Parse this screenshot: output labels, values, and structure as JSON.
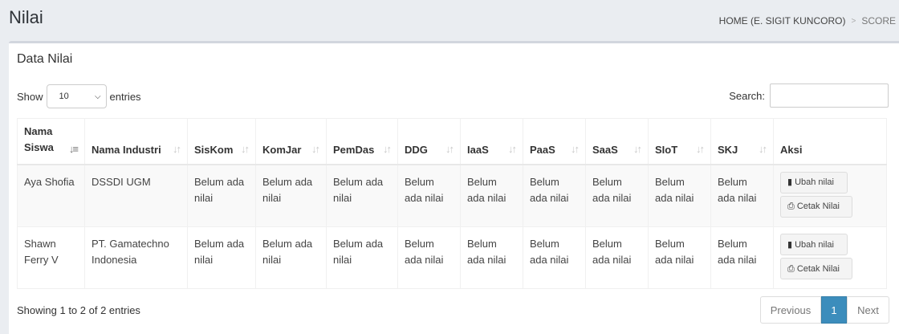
{
  "page": {
    "title": "Nilai"
  },
  "breadcrumb": {
    "home": "HOME (E. SIGIT KUNCORO)",
    "separator": ">",
    "current": "SCORE"
  },
  "card": {
    "title": "Data Nilai"
  },
  "controls": {
    "show_label": "Show",
    "length_value": "10",
    "entries_label": "entries",
    "search_label": "Search:",
    "search_value": ""
  },
  "table": {
    "columns": [
      "Nama Siswa",
      "Nama Industri",
      "SisKom",
      "KomJar",
      "PemDas",
      "DDG",
      "IaaS",
      "PaaS",
      "SaaS",
      "SIoT",
      "SKJ",
      "Aksi"
    ],
    "rows": [
      {
        "nama_siswa": "Aya Shofia",
        "nama_industri": "DSSDI UGM",
        "scores": [
          "Belum ada nilai",
          "Belum ada nilai",
          "Belum ada nilai",
          "Belum ada nilai",
          "Belum ada nilai",
          "Belum ada nilai",
          "Belum ada nilai",
          "Belum ada nilai",
          "Belum ada nilai"
        ]
      },
      {
        "nama_siswa": "Shawn Ferry V",
        "nama_industri": "PT. Gamatechno Indonesia",
        "scores": [
          "Belum ada nilai",
          "Belum ada nilai",
          "Belum ada nilai",
          "Belum ada nilai",
          "Belum ada nilai",
          "Belum ada nilai",
          "Belum ada nilai",
          "Belum ada nilai",
          "Belum ada nilai"
        ]
      }
    ],
    "actions": {
      "edit_label": "Ubah nilai",
      "print_label": "Cetak Nilai",
      "edit_icon": "file-icon",
      "print_icon": "print-icon"
    }
  },
  "footer": {
    "info": "Showing 1 to 2 of 2 entries",
    "previous_label": "Previous",
    "current_page": "1",
    "next_label": "Next"
  },
  "colors": {
    "accent": "#3c8dbc",
    "background": "#eaedf1"
  }
}
